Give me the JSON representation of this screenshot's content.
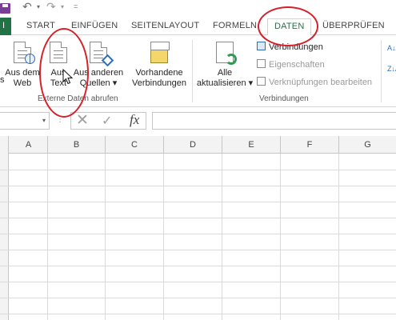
{
  "qat": {
    "undo_glyph": "↶",
    "redo_glyph": "↷",
    "dropdown_glyph": "▾",
    "customize_glyph": "="
  },
  "tabs": {
    "file": "I",
    "items": [
      "START",
      "EINFÜGEN",
      "SEITENLAYOUT",
      "FORMELN",
      "DATEN",
      "ÜBERPRÜFEN"
    ],
    "active": "DATEN"
  },
  "ribbon": {
    "external": {
      "group_label": "Externe Daten abrufen",
      "partial_left": "s",
      "web_line1": "Aus dem",
      "web_line2": "Web",
      "text_line1": "Aus",
      "text_line2": "Text",
      "other_line1": "Aus anderen",
      "other_line2": "Quellen ▾",
      "existing_line1": "Vorhandene",
      "existing_line2": "Verbindungen"
    },
    "connections": {
      "group_label": "Verbindungen",
      "refresh_line1": "Alle",
      "refresh_line2": "aktualisieren ▾",
      "connections": "Verbindungen",
      "properties": "Eigenschaften",
      "edit_links": "Verknüpfungen bearbeiten"
    },
    "sort": {
      "az": "A↓Z",
      "za": "Z↓A"
    }
  },
  "formula_bar": {
    "name_dropdown": "▾",
    "dots": "⋮",
    "cancel": "✕",
    "enter": "✓",
    "fx": "fx",
    "value": ""
  },
  "grid": {
    "columns": [
      "A",
      "B",
      "C",
      "D",
      "E",
      "F",
      "G"
    ]
  },
  "colors": {
    "excel_green": "#217346",
    "annotation_red": "#d6202a",
    "icon_blue": "#2f6db5"
  }
}
